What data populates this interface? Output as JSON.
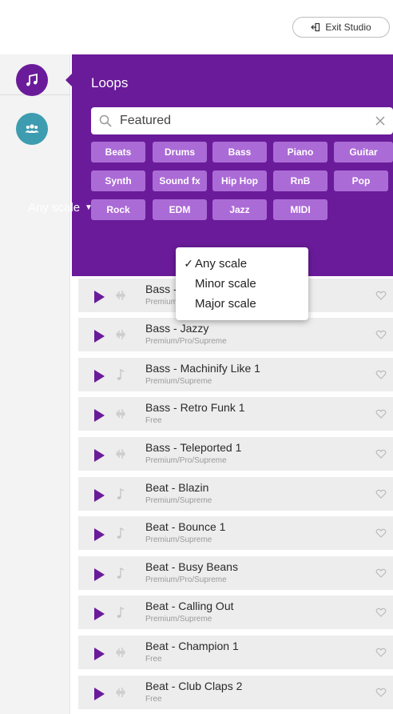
{
  "header": {
    "exit_label": "Exit Studio",
    "exit_icon": "exit-icon"
  },
  "sidebar": {
    "items": [
      {
        "name": "loops",
        "icon": "music-note-icon",
        "color": "#6a1b9a"
      },
      {
        "name": "collaborators",
        "icon": "users-icon",
        "color": "#3d9cb0"
      }
    ]
  },
  "panel": {
    "title": "Loops",
    "accent_color": "#6a1b9a",
    "tag_color": "#ab6bd6",
    "search": {
      "value": "Featured",
      "placeholder": ""
    },
    "tags": [
      "Beats",
      "Drums",
      "Bass",
      "Piano",
      "Guitar",
      "Synth",
      "Sound fx",
      "Hip Hop",
      "RnB",
      "Pop",
      "Rock",
      "EDM",
      "Jazz",
      "MIDI"
    ],
    "scale_filter": {
      "selected": "Any scale",
      "options": [
        "Any scale",
        "Minor scale",
        "Major scale"
      ],
      "checked_index": 0
    }
  },
  "loops": [
    {
      "title": "Bass - Jazzy",
      "tier": "Premium/Pro/Supreme",
      "icon": "waveform-icon"
    },
    {
      "title": "Bass - Jazzy",
      "tier": "Premium/Pro/Supreme",
      "icon": "waveform-icon"
    },
    {
      "title": "Bass - Machinify Like 1",
      "tier": "Premium/Supreme",
      "icon": "music-note-icon"
    },
    {
      "title": "Bass - Retro Funk 1",
      "tier": "Free",
      "icon": "waveform-icon"
    },
    {
      "title": "Bass - Teleported 1",
      "tier": "Premium/Pro/Supreme",
      "icon": "waveform-icon"
    },
    {
      "title": "Beat - Blazin",
      "tier": "Premium/Supreme",
      "icon": "music-note-icon"
    },
    {
      "title": "Beat - Bounce 1",
      "tier": "Premium/Supreme",
      "icon": "music-note-icon"
    },
    {
      "title": "Beat - Busy Beans",
      "tier": "Premium/Pro/Supreme",
      "icon": "music-note-icon"
    },
    {
      "title": "Beat - Calling Out",
      "tier": "Premium/Supreme",
      "icon": "music-note-icon"
    },
    {
      "title": "Beat - Champion 1",
      "tier": "Free",
      "icon": "waveform-icon"
    },
    {
      "title": "Beat - Club Claps 2",
      "tier": "Free",
      "icon": "waveform-icon"
    }
  ]
}
